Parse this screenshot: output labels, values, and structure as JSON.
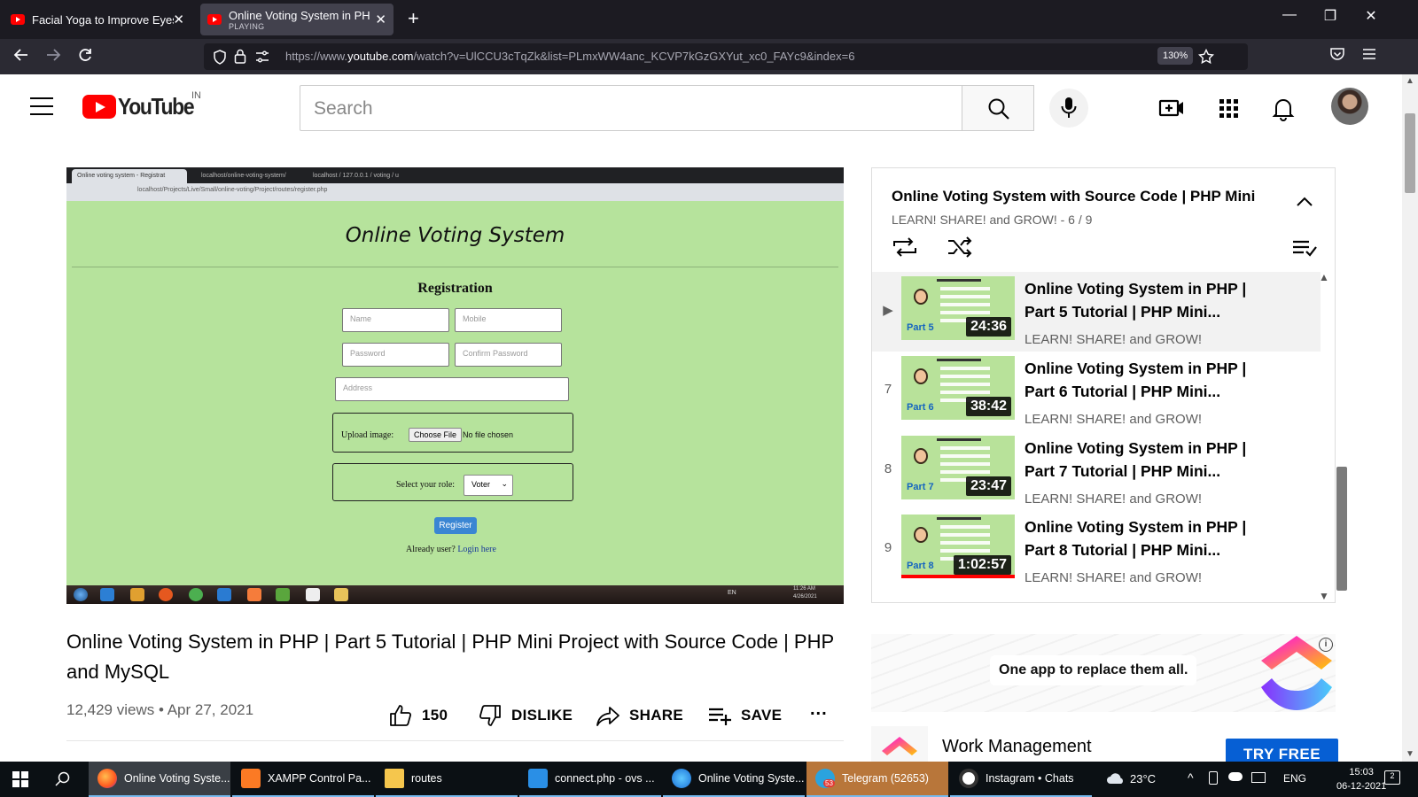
{
  "browser": {
    "tabs": [
      {
        "title": "Facial Yoga to Improve Eyesight",
        "sub": ""
      },
      {
        "title": "Online Voting System in PHP | P",
        "sub": "PLAYING"
      }
    ],
    "url_prefix": "https://www.",
    "url_domain": "youtube.com",
    "url_rest": "/watch?v=UlCCU3cTqZk&list=PLmxWW4anc_KCVP7kGzGXYut_xc0_FAYc9&index=6",
    "zoom": "130%",
    "icons": [
      "back-icon",
      "forward-icon",
      "reload-icon",
      "shield-icon",
      "lock-icon",
      "permissions-icon",
      "bookmark-star-icon",
      "pocket-icon",
      "menu-icon"
    ]
  },
  "youtube": {
    "logo_text": "YouTube",
    "country": "IN",
    "search_placeholder": "Search"
  },
  "video_frame": {
    "tabs": [
      "Online voting system - Registrat",
      "localhost/online-voting-system/",
      "localhost / 127.0.0.1 / voting / u"
    ],
    "url": "localhost/Projects/Live/Small/online-voting/Project/routes/register.php",
    "heading": "Online Voting System",
    "form_title": "Registration",
    "placeholders": {
      "name": "Name",
      "mobile": "Mobile",
      "password": "Password",
      "confirm": "Confirm Password",
      "address": "Address"
    },
    "upload_label": "Upload image:",
    "choose_file": "Choose File",
    "no_file": "No file chosen",
    "role_label": "Select your role:",
    "role_value": "Voter",
    "register": "Register",
    "already_user": "Already user?",
    "login_link": "Login here",
    "tray_lang": "EN",
    "tray_time": "11:26 AM",
    "tray_date": "4/26/2021"
  },
  "video": {
    "title": "Online Voting System in PHP | Part 5 Tutorial | PHP Mini Project with Source Code | PHP and MySQL",
    "views": "12,429 views",
    "sep": "•",
    "date": "Apr 27, 2021",
    "likes": "150",
    "dislike": "DISLIKE",
    "share": "SHARE",
    "save": "SAVE",
    "more": "..."
  },
  "playlist": {
    "title": "Online Voting System with Source Code | PHP Mini",
    "channel": "LEARN! SHARE! and GROW!",
    "position": "- 6 / 9",
    "items": [
      {
        "index": "▶",
        "line1": "Online Voting System in PHP |",
        "line2": "Part 5 Tutorial | PHP Mini...",
        "channel": "LEARN! SHARE! and GROW!",
        "part": "Part 5",
        "duration": "24:36",
        "active": true
      },
      {
        "index": "7",
        "line1": "Online Voting System in PHP |",
        "line2": "Part 6 Tutorial | PHP Mini...",
        "channel": "LEARN! SHARE! and GROW!",
        "part": "Part 6",
        "duration": "38:42",
        "active": false
      },
      {
        "index": "8",
        "line1": "Online Voting System in PHP |",
        "line2": "Part 7 Tutorial | PHP Mini...",
        "channel": "LEARN! SHARE! and GROW!",
        "part": "Part 7",
        "duration": "23:47",
        "active": false
      },
      {
        "index": "9",
        "line1": "Online Voting System in PHP |",
        "line2": "Part 8 Tutorial | PHP Mini...",
        "channel": "LEARN! SHARE! and GROW!",
        "part": "Part 8",
        "duration": "1:02:57",
        "active": false
      }
    ]
  },
  "ad": {
    "tagline": "One app to replace them all.",
    "info": "i",
    "product": "Work Management",
    "cta": "TRY FREE"
  },
  "taskbar": {
    "items": [
      "Online Voting Syste...",
      "XAMPP Control Pa...",
      "routes",
      "connect.php - ovs ...",
      "Online Voting Syste...",
      "Telegram (52653)",
      "Instagram • Chats"
    ],
    "telegram_badge": "53",
    "weather": "23°C",
    "lang": "ENG",
    "time": "15:03",
    "date": "06-12-2021",
    "notifications": "2"
  },
  "colors": {
    "youtube_red": "#ff0000",
    "link_blue": "#065fd4",
    "video_bg": "#b6e39c",
    "taskbar": "#0b1014"
  }
}
